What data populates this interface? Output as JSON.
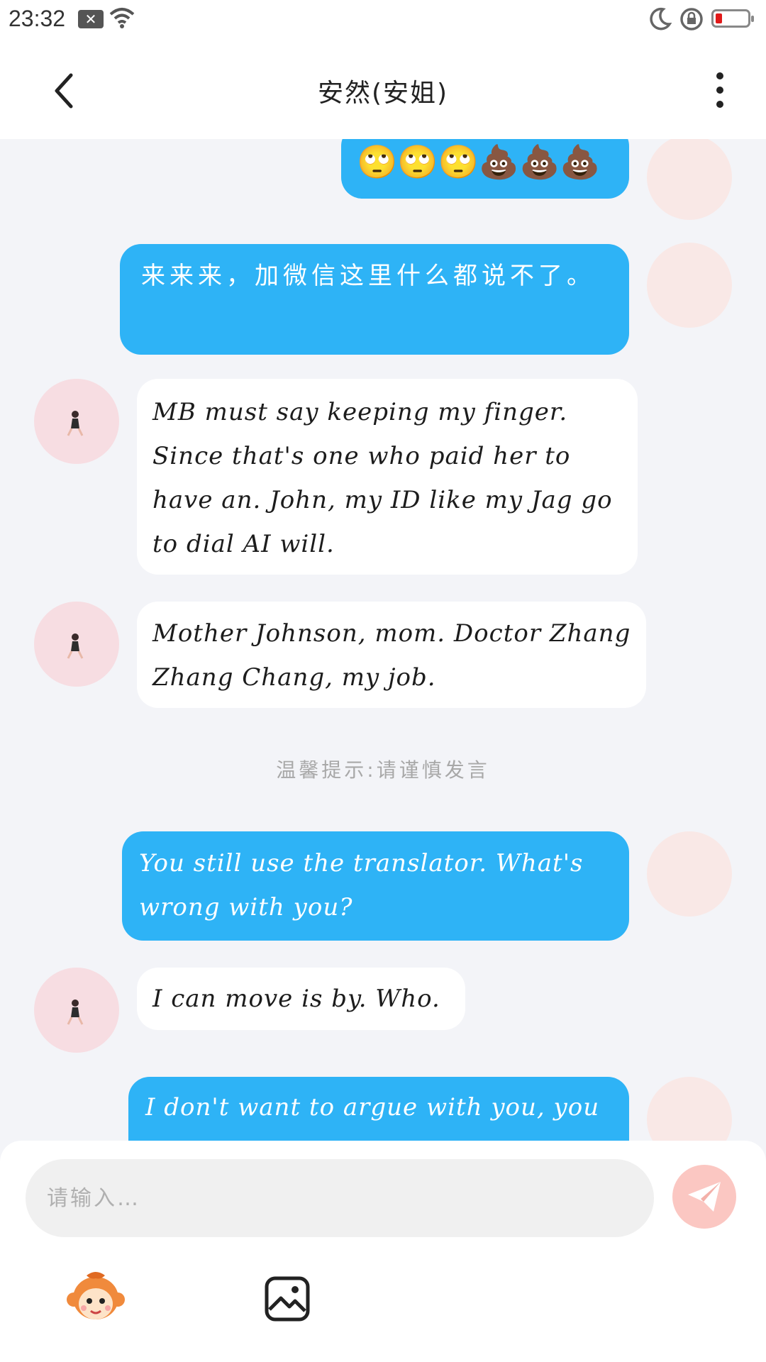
{
  "status_bar": {
    "time": "23:32",
    "icons": [
      "close-notification-icon",
      "wifi-icon",
      "moon-icon",
      "rotation-lock-icon",
      "battery-icon"
    ],
    "battery_color": "#e11919"
  },
  "header": {
    "title": "安然(安姐)",
    "back_icon": "chevron-left-icon",
    "more_icon": "more-vertical-icon"
  },
  "colors": {
    "outgoing_bubble": "#2eb3f6",
    "incoming_bubble": "#ffffff",
    "background": "#f3f4f8"
  },
  "messages": [
    {
      "direction": "out",
      "text": "🙄🙄🙄💩💩💩"
    },
    {
      "direction": "out",
      "text": "来来来，加微信这里什么都说不了。"
    },
    {
      "direction": "in",
      "text": "MB must say keeping my finger. Since that's one who paid her to have an. John, my ID like my Jag go to dial AI will."
    },
    {
      "direction": "in",
      "text": "Mother Johnson, mom. Doctor Zhang Zhang Chang, my job."
    },
    {
      "direction": "out",
      "text": "You still use the translator. What's wrong with you?"
    },
    {
      "direction": "in",
      "text": "I can move is by. Who."
    },
    {
      "direction": "out",
      "text": "I don't want to argue with you, you"
    }
  ],
  "hint": "温馨提示:请谨慎发言",
  "input": {
    "placeholder": "请输入…",
    "value": ""
  },
  "toolbar": {
    "sticker_icon": "monkey-sticker-icon",
    "image_icon": "image-icon",
    "send_icon": "paper-plane-icon"
  }
}
